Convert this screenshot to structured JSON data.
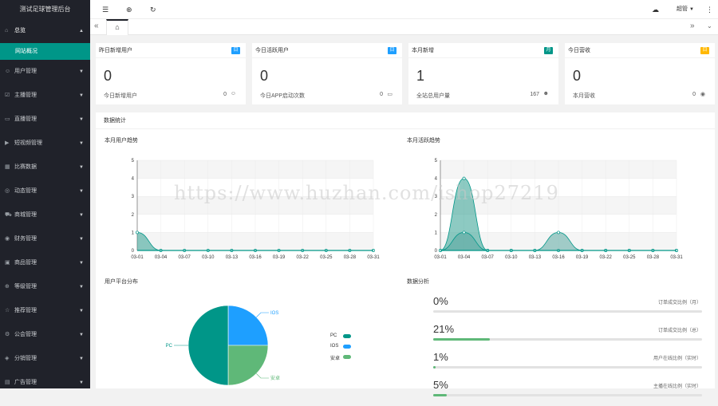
{
  "app": {
    "title": "测试足球管理后台"
  },
  "sidebar": {
    "items": [
      {
        "label": "总览",
        "icon": "home-icon"
      },
      {
        "label": "用户管理",
        "icon": "users-icon"
      },
      {
        "label": "主播管理",
        "icon": "anchor-icon"
      },
      {
        "label": "直播管理",
        "icon": "live-icon"
      },
      {
        "label": "短视频管理",
        "icon": "video-icon"
      },
      {
        "label": "比赛数据",
        "icon": "match-icon"
      },
      {
        "label": "动态管理",
        "icon": "dynamic-icon"
      },
      {
        "label": "商城管理",
        "icon": "cart-icon"
      },
      {
        "label": "财务管理",
        "icon": "finance-icon"
      },
      {
        "label": "商品管理",
        "icon": "goods-icon"
      },
      {
        "label": "等级管理",
        "icon": "level-icon"
      },
      {
        "label": "推荐管理",
        "icon": "star-icon"
      },
      {
        "label": "公会管理",
        "icon": "guild-icon"
      },
      {
        "label": "分销管理",
        "icon": "share-icon"
      },
      {
        "label": "广告管理",
        "icon": "ad-icon"
      }
    ],
    "sub_item": "网站概况"
  },
  "header": {
    "user": "超管"
  },
  "stats": [
    {
      "title": "昨日新增用户",
      "badge": "日",
      "badge_color": "#1e9fff",
      "value": "0",
      "foot": "今日新增用户",
      "num": "0"
    },
    {
      "title": "今日活跃用户",
      "badge": "日",
      "badge_color": "#1e9fff",
      "value": "0",
      "foot": "今日APP启动次数",
      "num": "0"
    },
    {
      "title": "本月新增",
      "badge": "月",
      "badge_color": "#009688",
      "value": "1",
      "foot": "全站总用户量",
      "num": "167"
    },
    {
      "title": "今日营收",
      "badge": "日",
      "badge_color": "#ffb800",
      "value": "0",
      "foot": "本月营收",
      "num": "0"
    }
  ],
  "panel": {
    "title": "数据统计"
  },
  "chart_data": [
    {
      "type": "area",
      "title": "本月用户趋势",
      "x": [
        "03-01",
        "03-04",
        "03-07",
        "03-10",
        "03-13",
        "03-16",
        "03-19",
        "03-22",
        "03-25",
        "03-28",
        "03-31"
      ],
      "series": [
        {
          "values": [
            1,
            0,
            0,
            0,
            0,
            0,
            0,
            0,
            0,
            0,
            0
          ]
        }
      ],
      "ylim": [
        0,
        5
      ]
    },
    {
      "type": "area",
      "title": "本月活跃趋势",
      "x": [
        "03-01",
        "03-04",
        "03-07",
        "03-10",
        "03-13",
        "03-16",
        "03-19",
        "03-22",
        "03-25",
        "03-28",
        "03-31"
      ],
      "series": [
        {
          "values": [
            0,
            4,
            0,
            0,
            0,
            0,
            0,
            0,
            0,
            0,
            0
          ]
        },
        {
          "values": [
            0,
            1,
            0,
            0,
            0,
            1,
            0,
            0,
            0,
            0,
            0
          ]
        }
      ],
      "ylim": [
        0,
        5
      ]
    },
    {
      "type": "pie",
      "title": "用户平台分布",
      "categories": [
        "PC",
        "IOS",
        "安卓"
      ],
      "values": [
        50,
        25,
        25
      ],
      "colors": [
        "#009688",
        "#1e9fff",
        "#5fb878"
      ]
    }
  ],
  "analysis": {
    "title": "数据分析",
    "rows": [
      {
        "value": "0%",
        "label": "订单成交比例（月）",
        "fill": 0
      },
      {
        "value": "21%",
        "label": "订单成交比例（总）",
        "fill": 21
      },
      {
        "value": "1%",
        "label": "用户在线比例（实时）",
        "fill": 1
      },
      {
        "value": "5%",
        "label": "主播在线比例（实时）",
        "fill": 5
      }
    ]
  },
  "watermark": "https://www.huzhan.com/ishop27219"
}
